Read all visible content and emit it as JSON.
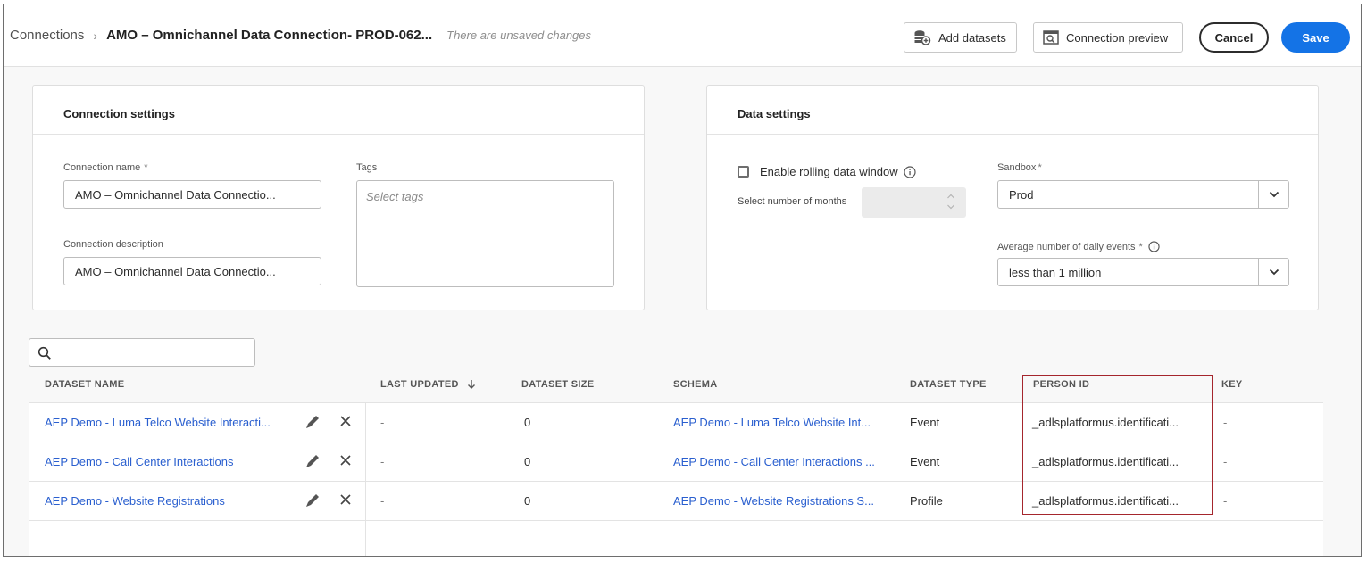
{
  "header": {
    "breadcrumb_root": "Connections",
    "breadcrumb_separator": "›",
    "title": "AMO – Omnichannel Data Connection- PROD-062...",
    "unsaved_note": "There are unsaved changes",
    "add_datasets_label": "Add datasets",
    "preview_label": "Connection preview",
    "cancel_label": "Cancel",
    "save_label": "Save"
  },
  "connection_settings": {
    "title": "Connection settings",
    "name_label": "Connection name",
    "name_value": "AMO – Omnichannel Data Connectio...",
    "description_label": "Connection description",
    "description_value": "AMO – Omnichannel Data Connectio...",
    "tags_label": "Tags",
    "tags_placeholder": "Select tags",
    "required_mark": "*"
  },
  "data_settings": {
    "title": "Data settings",
    "rolling_label": "Enable rolling data window",
    "months_label": "Select number of months",
    "sandbox_label": "Sandbox",
    "sandbox_value": "Prod",
    "events_label": "Average number of daily events",
    "events_value": "less than 1 million",
    "required_mark": "*"
  },
  "table": {
    "headers": {
      "name": "DATASET NAME",
      "updated": "LAST UPDATED",
      "size": "DATASET SIZE",
      "schema": "SCHEMA",
      "type": "DATASET TYPE",
      "person": "PERSON ID",
      "key": "KEY"
    },
    "rows": [
      {
        "name": "AEP Demo - Luma Telco Website Interacti...",
        "updated": "-",
        "size": "0",
        "schema": "AEP Demo - Luma Telco Website Int...",
        "type": "Event",
        "person": "_adlsplatformus.identificati...",
        "key": "-"
      },
      {
        "name": "AEP Demo - Call Center Interactions",
        "updated": "-",
        "size": "0",
        "schema": "AEP Demo - Call Center Interactions ...",
        "type": "Event",
        "person": "_adlsplatformus.identificati...",
        "key": "-"
      },
      {
        "name": "AEP Demo - Website Registrations",
        "updated": "-",
        "size": "0",
        "schema": "AEP Demo - Website Registrations S...",
        "type": "Profile",
        "person": "_adlsplatformus.identificati...",
        "key": "-"
      }
    ]
  },
  "colors": {
    "accent": "#1473e6",
    "link": "#2a5fcf",
    "highlight": "#a5262d"
  }
}
